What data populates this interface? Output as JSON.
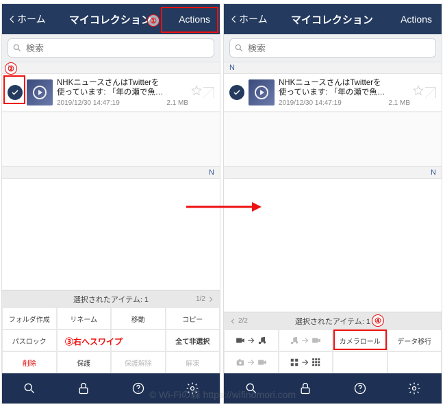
{
  "header": {
    "back_label": "ホーム",
    "title": "マイコレクション",
    "actions_label": "Actions"
  },
  "search": {
    "placeholder": "検索"
  },
  "section_letter": "N",
  "item": {
    "title_l1": "NHKニュースさんはTwitterを",
    "title_l2": "使っています: 「年の瀬で魚…",
    "date": "2019/12/30 14:47:19",
    "size": "2.1 MB"
  },
  "selected_bar": {
    "label": "選択されたアイテム: 1",
    "page_left": "1/2",
    "page_right": "2/2"
  },
  "grid_left": {
    "r1": [
      "フォルダ作成",
      "リネーム",
      "移動",
      "コピー"
    ],
    "r2": [
      "パスロック",
      "",
      "",
      "全て非選択"
    ],
    "r3": [
      "削除",
      "保護",
      "保護解除",
      "解凍"
    ]
  },
  "grid_right": {
    "camera_roll": "カメラロール",
    "data_migrate": "データ移行"
  },
  "annotations": {
    "n1": "①",
    "n2": "②",
    "n3": "③",
    "n4": "④",
    "swipe_right": "右へスワイプ"
  },
  "watermark": "© Wi-Fiの森   https://wifinomori.com"
}
